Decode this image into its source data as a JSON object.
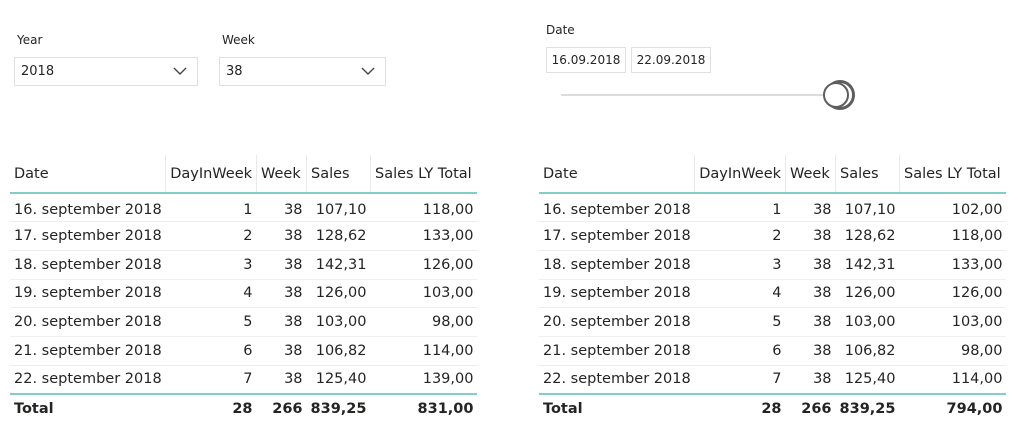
{
  "slicers": {
    "year": {
      "label": "Year",
      "value": "2018"
    },
    "week": {
      "label": "Week",
      "value": "38"
    },
    "date": {
      "label": "Date",
      "start": "16.09.2018",
      "end": "22.09.2018"
    }
  },
  "tables": [
    {
      "columns": [
        "Date",
        "DayInWeek",
        "Week",
        "Sales",
        "Sales LY Total"
      ],
      "rows": [
        [
          "16. september 2018",
          "1",
          "38",
          "107,10",
          "118,00"
        ],
        [
          "17. september 2018",
          "2",
          "38",
          "128,62",
          "133,00"
        ],
        [
          "18. september 2018",
          "3",
          "38",
          "142,31",
          "126,00"
        ],
        [
          "19. september 2018",
          "4",
          "38",
          "126,00",
          "103,00"
        ],
        [
          "20. september 2018",
          "5",
          "38",
          "103,00",
          "98,00"
        ],
        [
          "21. september 2018",
          "6",
          "38",
          "106,82",
          "114,00"
        ],
        [
          "22. september 2018",
          "7",
          "38",
          "125,40",
          "139,00"
        ]
      ],
      "total": [
        "Total",
        "28",
        "266",
        "839,25",
        "831,00"
      ]
    },
    {
      "columns": [
        "Date",
        "DayInWeek",
        "Week",
        "Sales",
        "Sales LY Total"
      ],
      "rows": [
        [
          "16. september 2018",
          "1",
          "38",
          "107,10",
          "102,00"
        ],
        [
          "17. september 2018",
          "2",
          "38",
          "128,62",
          "118,00"
        ],
        [
          "18. september 2018",
          "3",
          "38",
          "142,31",
          "133,00"
        ],
        [
          "19. september 2018",
          "4",
          "38",
          "126,00",
          "126,00"
        ],
        [
          "20. september 2018",
          "5",
          "38",
          "103,00",
          "103,00"
        ],
        [
          "21. september 2018",
          "6",
          "38",
          "106,82",
          "98,00"
        ],
        [
          "22. september 2018",
          "7",
          "38",
          "125,40",
          "114,00"
        ]
      ],
      "total": [
        "Total",
        "28",
        "266",
        "839,25",
        "794,00"
      ]
    }
  ]
}
